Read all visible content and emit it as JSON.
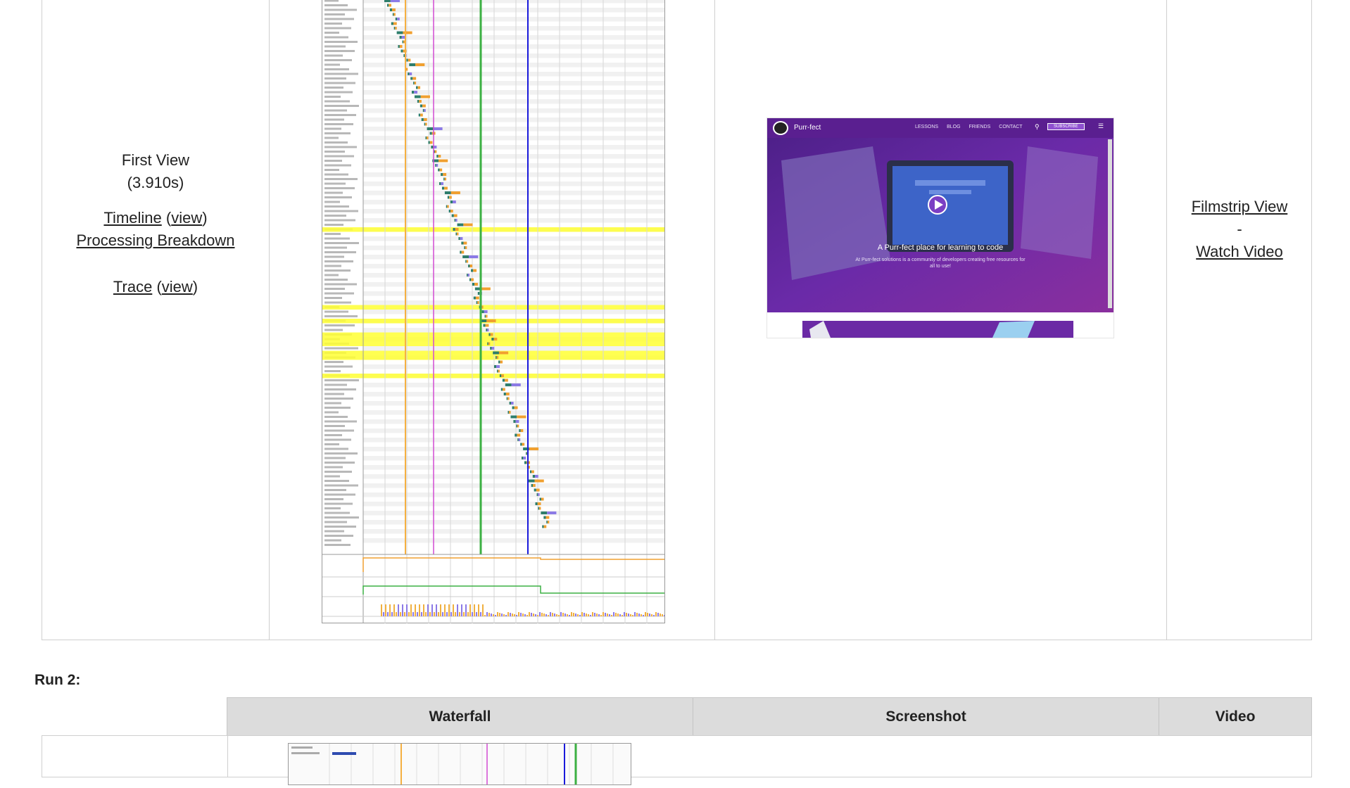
{
  "run1": {
    "first_view": {
      "title": "First View",
      "time": "(3.910s)",
      "timeline_label": "Timeline",
      "paren_open": "(",
      "view_label": "view",
      "paren_close": ")",
      "processing_label": "Processing Breakdown",
      "trace_label": "Trace"
    },
    "screenshot": {
      "site_name": "Purr-fect",
      "nav": [
        "LESSONS",
        "BLOG",
        "FRIENDS",
        "CONTACT"
      ],
      "subscribe": "SUBSCRIBE",
      "hero_title": "A Purr-fect place for learning to code",
      "hero_subtitle": "At Purr-fect solutions is a community of developers creating free resources for all to use!"
    },
    "video": {
      "filmstrip_label": "Filmstrip View",
      "separator": "-",
      "watch_label": "Watch Video"
    }
  },
  "run2": {
    "label": "Run 2:",
    "headers": [
      "Waterfall",
      "Screenshot",
      "Video"
    ]
  },
  "colors": {
    "start_render": "#f5b041",
    "dom_content": "#d24bd2",
    "document_complete": "#3cb043",
    "fully_loaded": "#1a1adb",
    "highlight_row": "#ffff33"
  }
}
